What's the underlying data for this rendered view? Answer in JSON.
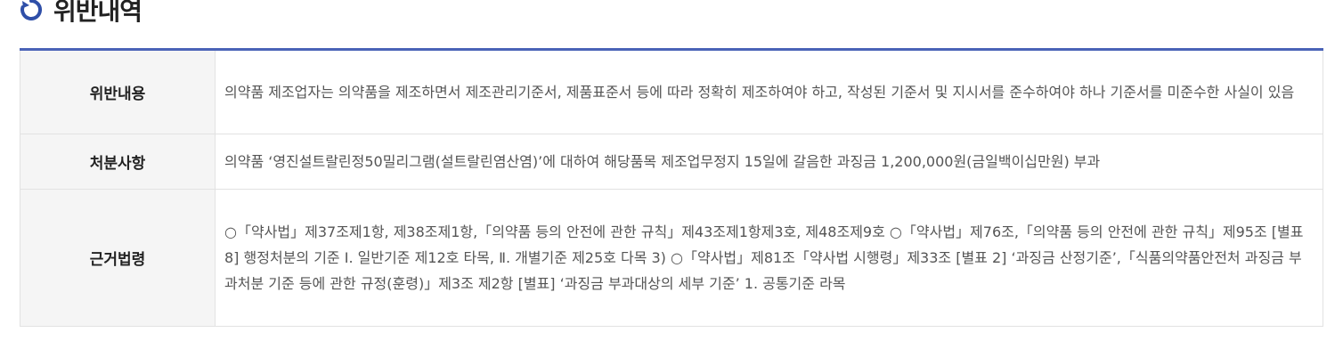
{
  "section": {
    "title": "위반내역",
    "icon": "refresh-circle-icon",
    "icon_color": "#2f4fa8"
  },
  "accent_color": "#4a63b7",
  "table": {
    "rows": [
      {
        "header": "위반내용",
        "content": "의약품 제조업자는 의약품을 제조하면서 제조관리기준서, 제품표준서 등에 따라 정확히 제조하여야 하고, 작성된 기준서 및 지시서를 준수하여야 하나 기준서를 미준수한 사실이 있음"
      },
      {
        "header": "처분사항",
        "content": "의약품 ‘영진설트랄린정50밀리그램(설트랄린염산염)’에 대하여 해당품목 제조업무정지 15일에 갈음한 과징금 1,200,000원(금일백이십만원) 부과"
      },
      {
        "header": "근거법령",
        "content": "○「약사법」제37조제1항, 제38조제1항,「의약품 등의 안전에 관한 규칙」제43조제1항제3호, 제48조제9호 ○「약사법」제76조,「의약품 등의 안전에 관한 규칙」제95조 [별표 8] 행정처분의 기준 Ⅰ. 일반기준 제12호 타목, Ⅱ. 개별기준 제25호 다목 3) ○「약사법」제81조「약사법 시행령」제33조 [별표 2] ‘과징금 산정기준’,「식품의약품안전처 과징금 부과처분 기준 등에 관한 규정(훈령)」제3조 제2항 [별표] ‘과징금 부과대상의 세부 기준’ 1. 공통기준 라목"
      }
    ]
  }
}
